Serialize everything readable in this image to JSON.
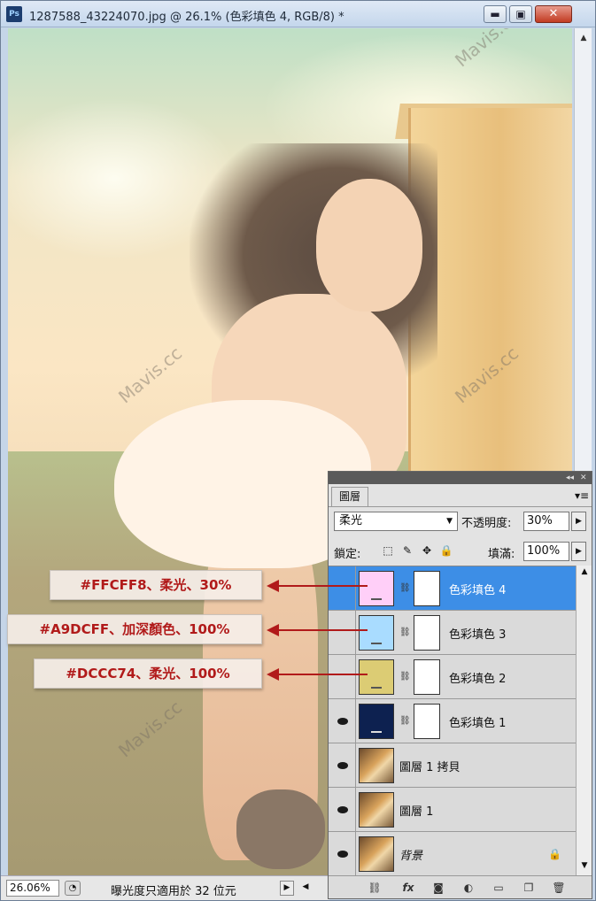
{
  "window": {
    "app_icon": "Ps",
    "title": "1287588_43224070.jpg @ 26.1% (色彩填色 4, RGB/8) *",
    "minimize_glyph": "▬",
    "maximize_glyph": "▣",
    "close_glyph": "✕"
  },
  "canvas": {
    "watermarks": [
      "Mavis.cc",
      "Mavis.cc",
      "Mavis.cc",
      "Mavis.cc"
    ]
  },
  "statusbar": {
    "zoom": "26.06%",
    "info_text": "曝光度只適用於 32 位元",
    "menu_arrow": "▶",
    "prev_arrow": "◀"
  },
  "layers_panel": {
    "tab_label": "圖層",
    "menu_icon": "▾≡",
    "collapse_icon": "◂◂",
    "close_icon": "✕",
    "blend_mode": "柔光",
    "opacity_label": "不透明度:",
    "opacity_value": "30%",
    "lock_label": "鎖定:",
    "fill_label": "填滿:",
    "fill_value": "100%",
    "layers": [
      {
        "name": "色彩填色 4",
        "color": "#FFCFF8",
        "type": "fill",
        "visible": false,
        "selected": true
      },
      {
        "name": "色彩填色 3",
        "color": "#A9DCFF",
        "type": "fill",
        "visible": false,
        "selected": false
      },
      {
        "name": "色彩填色 2",
        "color": "#DCCC74",
        "type": "fill",
        "visible": false,
        "selected": false
      },
      {
        "name": "色彩填色 1",
        "color": "#0D2150",
        "type": "fill",
        "visible": true,
        "selected": false
      },
      {
        "name": "圖層 1 拷貝",
        "type": "pixel",
        "visible": true,
        "selected": false
      },
      {
        "name": "圖層 1",
        "type": "pixel",
        "visible": true,
        "selected": false
      },
      {
        "name": "背景",
        "type": "background",
        "visible": true,
        "selected": false,
        "locked": true
      }
    ]
  },
  "annotations": [
    {
      "text": "#FFCFF8、柔光、30%"
    },
    {
      "text": "#A9DCFF、加深顏色、100%"
    },
    {
      "text": "#DCCC74、柔光、100%"
    }
  ],
  "colors": {
    "annotation": "#B11A1A",
    "selection": "#3D8EE6"
  }
}
